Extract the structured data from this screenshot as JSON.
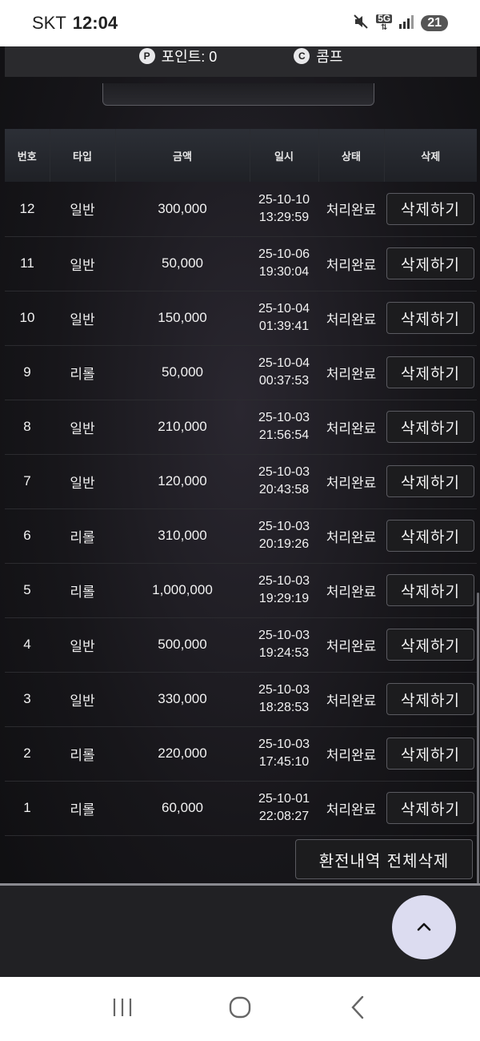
{
  "status_bar": {
    "carrier": "SKT",
    "time": "12:04",
    "network": "5G",
    "battery": "21",
    "icons": [
      "mute-icon",
      "network-5g-icon",
      "signal-icon",
      "battery-icon"
    ]
  },
  "points_bar": {
    "point_badge": "P",
    "point_label": "포인트: 0",
    "comp_badge": "C",
    "comp_label": "콤프"
  },
  "table": {
    "headers": {
      "no": "번호",
      "type": "타입",
      "amount": "금액",
      "datetime": "일시",
      "status": "상태",
      "delete": "삭제"
    },
    "rows": [
      {
        "no": "12",
        "type": "일반",
        "amount": "300,000",
        "date": "25-10-10",
        "time": "13:29:59",
        "status": "처리완료",
        "action": "삭제하기"
      },
      {
        "no": "11",
        "type": "일반",
        "amount": "50,000",
        "date": "25-10-06",
        "time": "19:30:04",
        "status": "처리완료",
        "action": "삭제하기"
      },
      {
        "no": "10",
        "type": "일반",
        "amount": "150,000",
        "date": "25-10-04",
        "time": "01:39:41",
        "status": "처리완료",
        "action": "삭제하기"
      },
      {
        "no": "9",
        "type": "리롤",
        "amount": "50,000",
        "date": "25-10-04",
        "time": "00:37:53",
        "status": "처리완료",
        "action": "삭제하기"
      },
      {
        "no": "8",
        "type": "일반",
        "amount": "210,000",
        "date": "25-10-03",
        "time": "21:56:54",
        "status": "처리완료",
        "action": "삭제하기"
      },
      {
        "no": "7",
        "type": "일반",
        "amount": "120,000",
        "date": "25-10-03",
        "time": "20:43:58",
        "status": "처리완료",
        "action": "삭제하기"
      },
      {
        "no": "6",
        "type": "리롤",
        "amount": "310,000",
        "date": "25-10-03",
        "time": "20:19:26",
        "status": "처리완료",
        "action": "삭제하기"
      },
      {
        "no": "5",
        "type": "리롤",
        "amount": "1,000,000",
        "date": "25-10-03",
        "time": "19:29:19",
        "status": "처리완료",
        "action": "삭제하기"
      },
      {
        "no": "4",
        "type": "일반",
        "amount": "500,000",
        "date": "25-10-03",
        "time": "19:24:53",
        "status": "처리완료",
        "action": "삭제하기"
      },
      {
        "no": "3",
        "type": "일반",
        "amount": "330,000",
        "date": "25-10-03",
        "time": "18:28:53",
        "status": "처리완료",
        "action": "삭제하기"
      },
      {
        "no": "2",
        "type": "리롤",
        "amount": "220,000",
        "date": "25-10-03",
        "time": "17:45:10",
        "status": "처리완료",
        "action": "삭제하기"
      },
      {
        "no": "1",
        "type": "리롤",
        "amount": "60,000",
        "date": "25-10-01",
        "time": "22:08:27",
        "status": "처리완료",
        "action": "삭제하기"
      }
    ]
  },
  "clear_all_label": "환전내역 전체삭제",
  "fab_icon": "chevron-up-icon",
  "nav_bar": {
    "icons": [
      "recent-apps-icon",
      "home-icon",
      "back-icon"
    ]
  }
}
